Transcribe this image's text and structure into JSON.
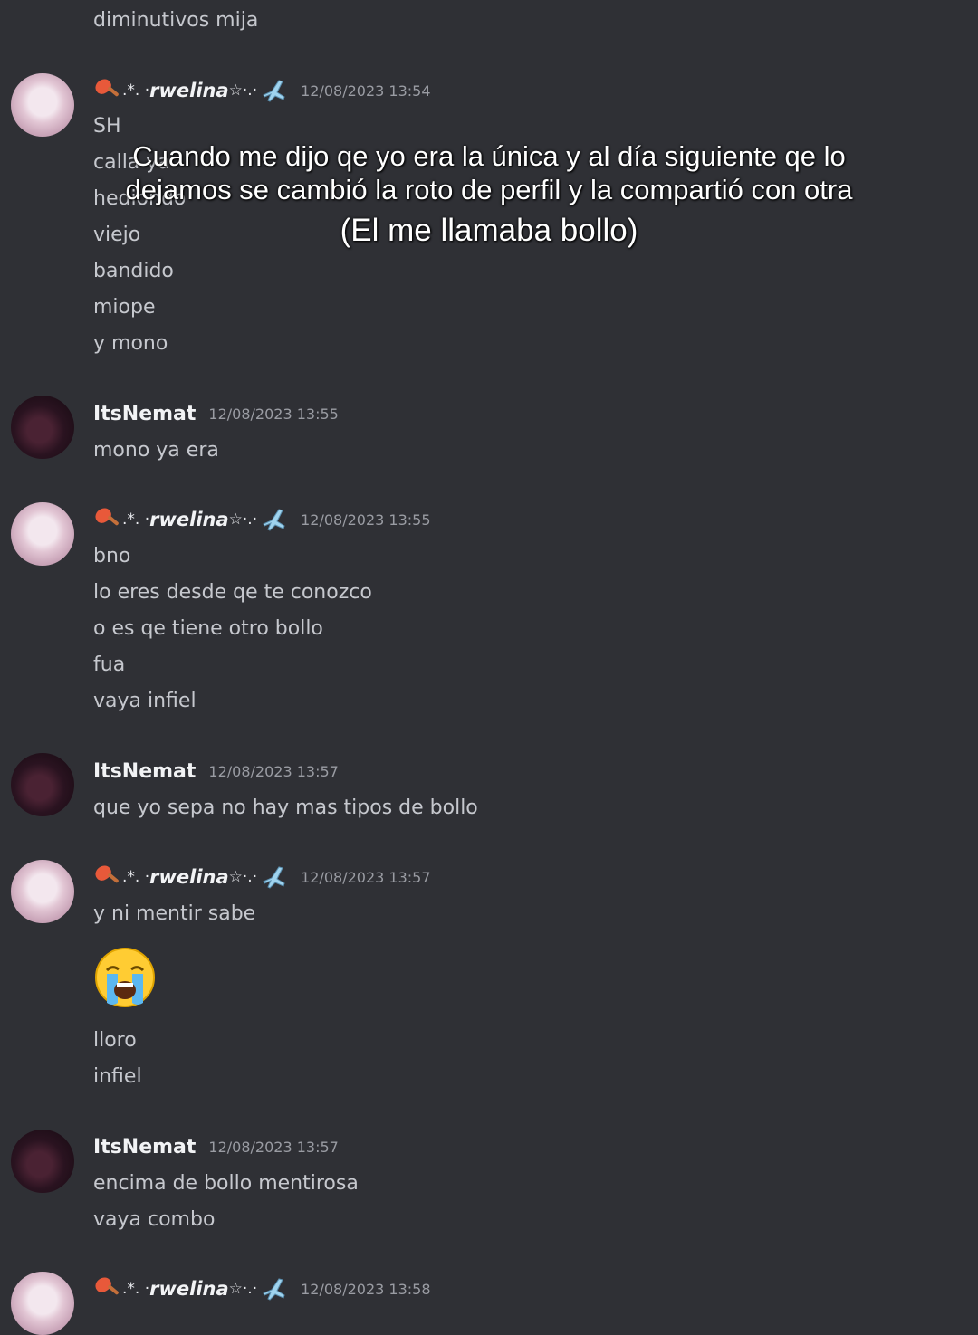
{
  "overlay_caption": {
    "line1": "Cuando me dijo qe yo era la única y al día siguiente qe lo",
    "line2": "dejamos se cambió la roto de perfil y la compartió con otra",
    "line3": "(El me llamaba bollo)"
  },
  "users": {
    "rwelina": {
      "prefix": ".*. ·",
      "name": "rwelina",
      "suffix": "☆·.·"
    },
    "nemat": {
      "name": "ItsNemat"
    }
  },
  "messages": {
    "top_fragment": "diminutivos mija",
    "g1": {
      "timestamp": "12/08/2023 13:54",
      "lines": [
        "SH",
        "calla ya",
        "hediondo",
        "viejo",
        "bandido",
        "miope",
        "y mono"
      ]
    },
    "g2": {
      "timestamp": "12/08/2023 13:55",
      "lines": [
        "mono ya era"
      ]
    },
    "g3": {
      "timestamp": "12/08/2023 13:55",
      "lines": [
        "bno",
        "lo eres desde qe te conozco",
        "o es qe tiene otro bollo",
        "fua",
        "vaya infiel"
      ]
    },
    "g4": {
      "timestamp": "12/08/2023 13:57",
      "lines": [
        "que yo sepa no hay mas tipos de bollo"
      ]
    },
    "g5": {
      "timestamp": "12/08/2023 13:57",
      "lines": [
        "y ni mentir sabe",
        "lloro",
        "infiel"
      ],
      "emoji": "loudly-crying-face"
    },
    "g6": {
      "timestamp": "12/08/2023 13:57",
      "lines": [
        "encima de bollo mentirosa",
        "vaya combo"
      ]
    },
    "g7": {
      "timestamp": "12/08/2023 13:58"
    }
  }
}
